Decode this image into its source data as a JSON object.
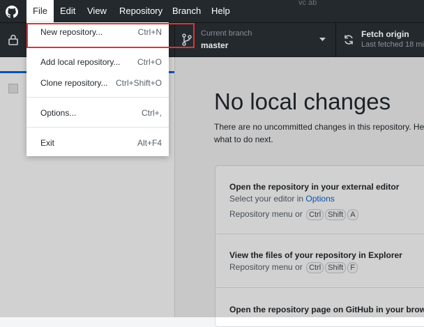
{
  "menubar": {
    "items": [
      "File",
      "Edit",
      "View",
      "Repository",
      "Branch",
      "Help"
    ]
  },
  "window_title_fragment": "vc   ab",
  "toolbar": {
    "branch_label": "Current branch",
    "branch_value": "master",
    "fetch_label": "Fetch origin",
    "fetch_sub": "Last fetched 18 mi"
  },
  "file_menu": {
    "items": [
      {
        "label": "New repository...",
        "shortcut": "Ctrl+N"
      },
      {
        "label": "Add local repository...",
        "shortcut": "Ctrl+O"
      },
      {
        "label": "Clone repository...",
        "shortcut": "Ctrl+Shift+O"
      },
      {
        "label": "Options...",
        "shortcut": "Ctrl+,"
      },
      {
        "label": "Exit",
        "shortcut": "Alt+F4"
      }
    ]
  },
  "main": {
    "title": "No local changes",
    "desc_line1": "There are no uncommitted changes in this repository. He",
    "desc_line2": "what to do next.",
    "cards": [
      {
        "title": "Open the repository in your external editor",
        "text": "Select your editor in ",
        "link": "Options",
        "hint": "Repository menu or",
        "keys": [
          "Ctrl",
          "Shift",
          "A"
        ]
      },
      {
        "title": "View the files of your repository in Explorer",
        "hint": "Repository menu or",
        "keys": [
          "Ctrl",
          "Shift",
          "F"
        ]
      },
      {
        "title": "Open the repository page on GitHub in your browse"
      }
    ]
  },
  "icons": {
    "logo": "github-logo-icon",
    "lock": "lock-icon",
    "branch": "git-branch-icon",
    "dropdown": "caret-down-icon",
    "sync": "sync-icon"
  },
  "colors": {
    "titlebar": "#24292e",
    "accent": "#0366d6",
    "highlight_box": "#e03333"
  }
}
